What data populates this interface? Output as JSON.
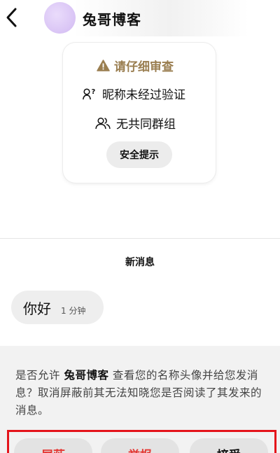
{
  "header": {
    "title": "兔哥博客"
  },
  "safety_card": {
    "warning": "请仔细审查",
    "nickname_unverified": "昵称未经过验证",
    "no_common_groups": "无共同群组",
    "safety_tips_button": "安全提示"
  },
  "conversation": {
    "section_title": "新消息",
    "messages": [
      {
        "text": "你好",
        "time": "1 分钟"
      }
    ]
  },
  "request": {
    "prompt_before": "是否允许 ",
    "sender": "兔哥博客",
    "prompt_after": " 查看您的名称头像并给您发消息？取消屏蔽前其无法知晓您是否阅读了其发来的消息。",
    "actions": {
      "block": "屏蔽",
      "report": "举报",
      "accept": "接受"
    }
  },
  "colors": {
    "warning": "#9a7e50",
    "destructive": "#e53935",
    "highlight_box": "#e4141b"
  }
}
